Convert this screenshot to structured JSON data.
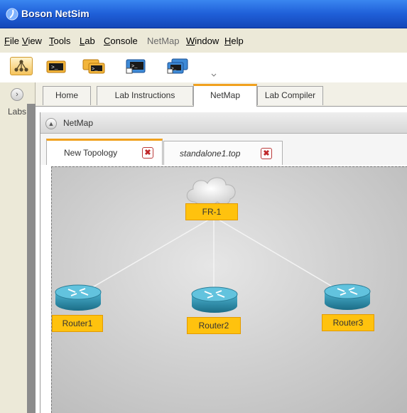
{
  "window": {
    "title": "Boson NetSim"
  },
  "menu": [
    {
      "label": "File",
      "accel": "F",
      "rest": "ile",
      "dim": false
    },
    {
      "label": "View",
      "accel": "V",
      "rest": "iew",
      "dim": false
    },
    {
      "label": "Tools",
      "accel": "T",
      "rest": "ools",
      "dim": false
    },
    {
      "label": "Lab",
      "accel": "L",
      "rest": "ab",
      "dim": false
    },
    {
      "label": "Console",
      "accel": "C",
      "rest": "onsole",
      "dim": false
    },
    {
      "label": "NetMap",
      "accel": "",
      "rest": "NetMap",
      "dim": true
    },
    {
      "label": "Window",
      "accel": "W",
      "rest": "indow",
      "dim": false
    },
    {
      "label": "Help",
      "accel": "H",
      "rest": "elp",
      "dim": false
    }
  ],
  "toolbar": {
    "buttons": [
      "topology-icon",
      "console-icon",
      "multi-console-icon",
      "console-1-icon",
      "console-2-icon"
    ]
  },
  "sidebar": {
    "label": "Labs"
  },
  "tabs": [
    {
      "label": "Home",
      "active": false
    },
    {
      "label": "Lab Instructions",
      "active": false
    },
    {
      "label": "NetMap",
      "active": true
    },
    {
      "label": "Lab Compiler",
      "active": false
    }
  ],
  "netmap": {
    "header": "NetMap",
    "doc_tabs": [
      {
        "label": "New Topology",
        "active": true,
        "italic": false
      },
      {
        "label": "standalone1.top",
        "active": false,
        "italic": true
      }
    ],
    "close_glyph": "✖",
    "nodes": [
      {
        "id": "fr1",
        "label": "FR-1",
        "kind": "cloud"
      },
      {
        "id": "r1",
        "label": "Router1",
        "kind": "router"
      },
      {
        "id": "r2",
        "label": "Router2",
        "kind": "router"
      },
      {
        "id": "r3",
        "label": "Router3",
        "kind": "router"
      }
    ],
    "links": [
      [
        "fr1",
        "r1"
      ],
      [
        "fr1",
        "r2"
      ],
      [
        "fr1",
        "r3"
      ]
    ]
  },
  "colors": {
    "titlebar": "#1f5fd8",
    "accent": "#f1a11e",
    "node_label_bg": "#ffc20e",
    "router_body": "#2f98b7",
    "close_red": "#c0282a"
  }
}
